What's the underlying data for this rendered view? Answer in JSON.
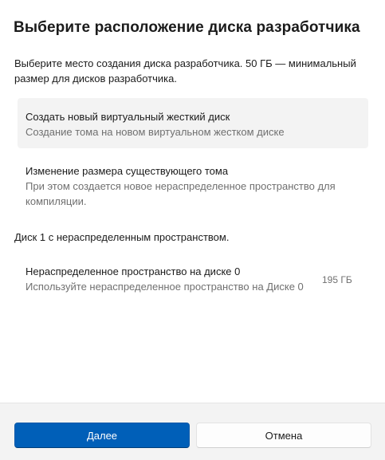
{
  "dialog": {
    "title": "Выберите расположение диска разработчика",
    "description": "Выберите место создания диска разработчика. 50 ГБ — минимальный размер для дисков разработчика."
  },
  "options": [
    {
      "title": "Создать новый виртуальный жесткий диск",
      "subtitle": "Создание тома на новом виртуальном жестком диске",
      "selected": true
    },
    {
      "title": "Изменение размера существующего тома",
      "subtitle": "При этом создается новое нераспределенное пространство для компиляции.",
      "selected": false
    }
  ],
  "disk": {
    "heading": "Диск 1 с нераспределенным пространством.",
    "item": {
      "title": "Нераспределенное пространство на диске 0",
      "subtitle": "Используйте нераспределенное пространство на Диске 0",
      "size": "195 ГБ"
    }
  },
  "footer": {
    "next_label": "Далее",
    "cancel_label": "Отмена"
  },
  "colors": {
    "accent": "#005fb8",
    "selected_bg": "#f3f3f3",
    "secondary_text": "#707070"
  }
}
